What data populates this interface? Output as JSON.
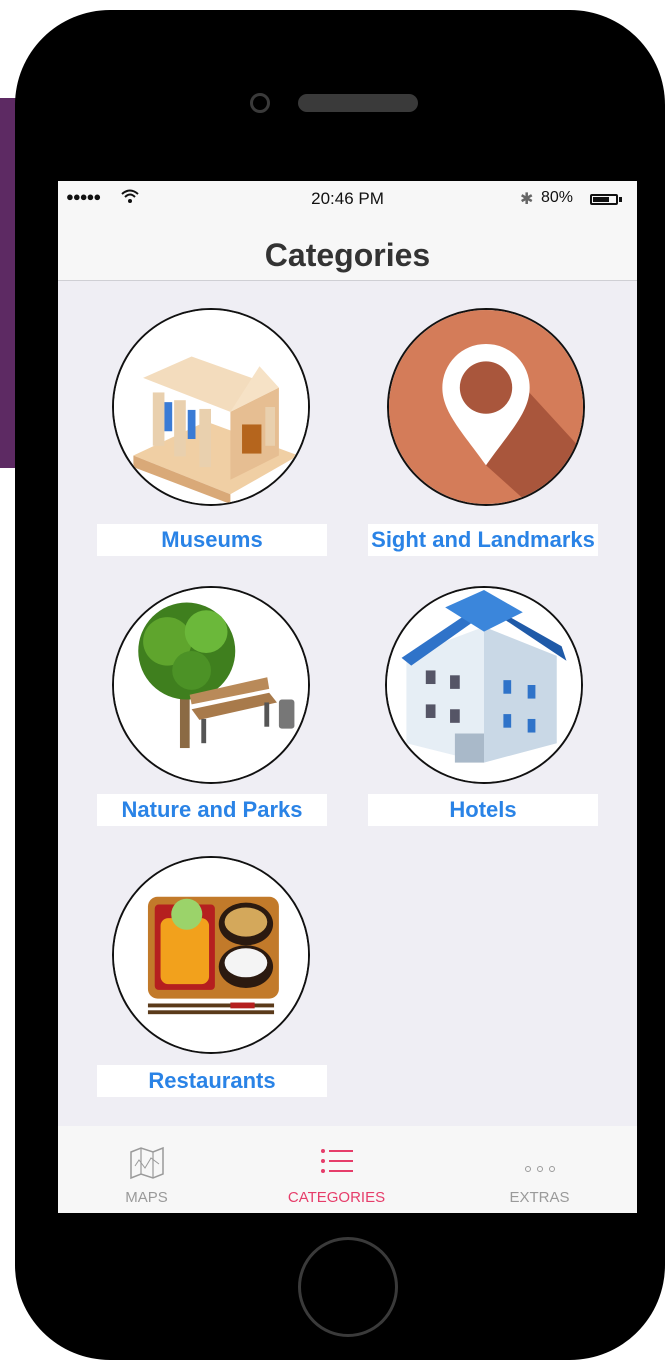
{
  "status_bar": {
    "signal": "●●●●●",
    "time": "20:46 PM",
    "battery_percent": "80%",
    "bluetooth_icon": "bluetooth-icon",
    "wifi_icon": "wifi-icon",
    "battery_level": 0.8
  },
  "navbar": {
    "title": "Categories"
  },
  "categories": [
    {
      "label": "Museums",
      "icon": "museum-building-icon"
    },
    {
      "label": "Sight and Landmarks",
      "icon": "map-pin-icon"
    },
    {
      "label": "Nature and Parks",
      "icon": "tree-bench-icon"
    },
    {
      "label": "Hotels",
      "icon": "hotel-building-icon"
    },
    {
      "label": "Restaurants",
      "icon": "food-tray-icon"
    }
  ],
  "tab_bar": {
    "tabs": [
      {
        "label": "MAPS",
        "icon": "map-icon",
        "active": false
      },
      {
        "label": "CATEGORIES",
        "icon": "list-icon",
        "active": true
      },
      {
        "label": "EXTRAS",
        "icon": "more-dots-icon",
        "active": false
      }
    ]
  },
  "colors": {
    "accent_blue": "#2a83e6",
    "active_tab": "#e63d6a",
    "screen_bg": "#efeef4",
    "phone_body": "#000000",
    "side_panel": "#5d2a63"
  }
}
